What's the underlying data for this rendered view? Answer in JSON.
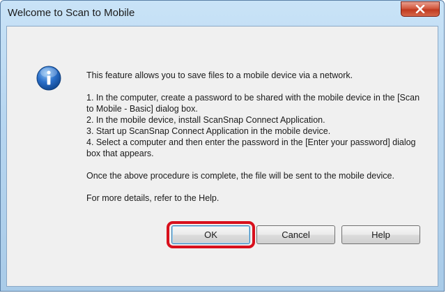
{
  "window": {
    "title": "Welcome to Scan to Mobile",
    "close_icon": "close-x-icon"
  },
  "icon": "info-icon",
  "message": {
    "intro": "This feature allows you to save files to a mobile device via a network.",
    "steps": [
      "1. In the computer, create a password to be shared with the mobile device in the [Scan to Mobile - Basic] dialog box.",
      "2. In the mobile device, install ScanSnap Connect Application.",
      "3. Start up ScanSnap Connect Application in the mobile device.",
      "4. Select a computer and then enter the password in the [Enter your password] dialog box that appears."
    ],
    "outro": "Once the above procedure is complete, the file will be sent to the mobile device.",
    "help_note": "For more details, refer to the Help."
  },
  "buttons": {
    "ok": "OK",
    "cancel": "Cancel",
    "help": "Help"
  },
  "colors": {
    "highlight": "#d8101c",
    "titlebar": "#b7d6f0",
    "info_icon": "#2a6fc9",
    "close_button": "#c03a20"
  }
}
